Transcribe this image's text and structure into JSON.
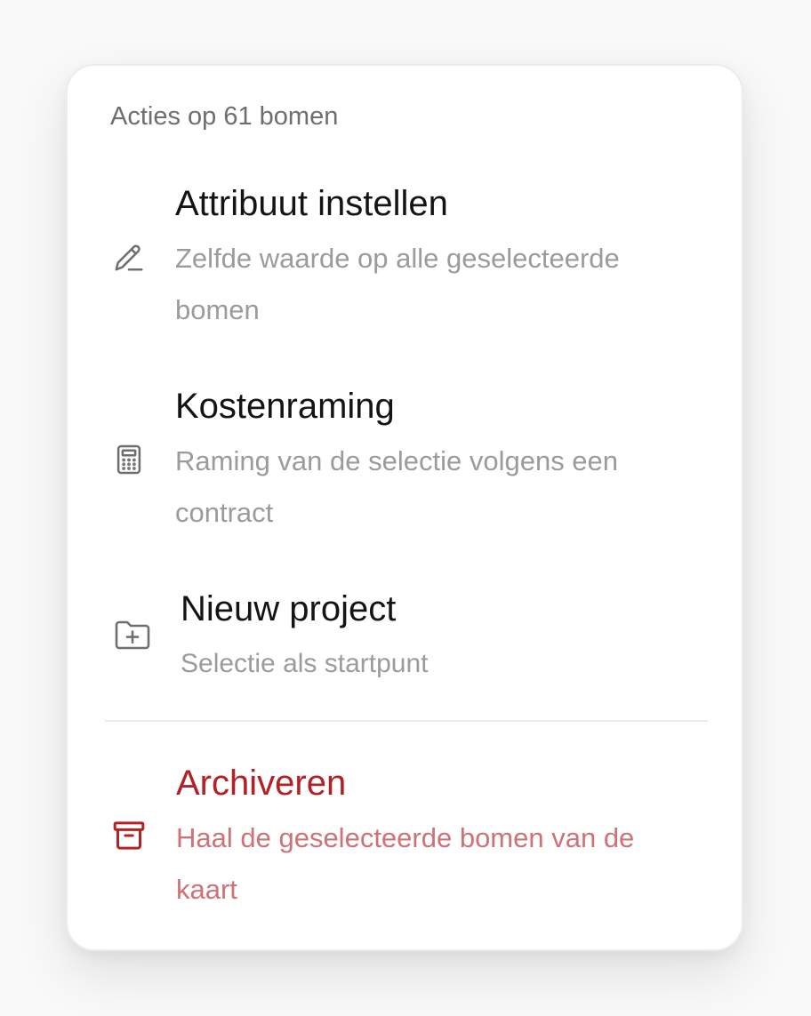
{
  "menu": {
    "header": "Acties op 61 bomen",
    "items": [
      {
        "id": "set-attribute",
        "icon": "pencil-icon",
        "title": "Attribuut instellen",
        "description": "Zelfde waarde op alle geselecteerde bomen"
      },
      {
        "id": "cost-estimate",
        "icon": "calculator-icon",
        "title": "Kostenraming",
        "description": "Raming van de selectie volgens een contract"
      },
      {
        "id": "new-project",
        "icon": "folder-plus-icon",
        "title": "Nieuw project",
        "description": "Selectie als startpunt"
      },
      {
        "id": "archive",
        "icon": "archive-icon",
        "title": "Archiveren",
        "description": "Haal de geselecteerde bomen van de kaart",
        "variant": "danger"
      }
    ]
  },
  "colors": {
    "title": "#141414",
    "description": "#9b9b9b",
    "header": "#6e6e6e",
    "danger": "#b32025",
    "danger_description": "#d07275",
    "icon": "#6f6f6f"
  }
}
